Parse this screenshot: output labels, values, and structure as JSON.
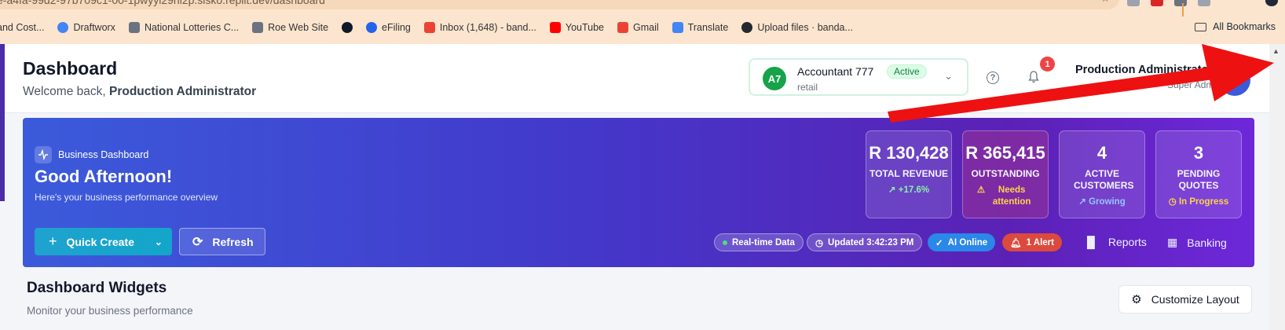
{
  "browser": {
    "url_fragment": "e-a4fa-99d2-97b709c1-00-1pwyyl29hl2p.sisko.replit.dev/dashboard",
    "bookmarks": [
      {
        "label": "and Cost...",
        "icon": "page-icon",
        "color": "#9ca3af"
      },
      {
        "label": "Draftworx",
        "icon": "chrome-icon",
        "color": "#4285f4"
      },
      {
        "label": "National Lotteries C...",
        "icon": "flag-icon",
        "color": "#6b7280"
      },
      {
        "label": "Roe Web Site",
        "icon": "image-icon",
        "color": "#6b7280"
      },
      {
        "label": "",
        "icon": "globe-icon",
        "color": "#111827"
      },
      {
        "label": "eFiling",
        "icon": "efiling-icon",
        "color": "#2563eb"
      },
      {
        "label": "Inbox (1,648) - band...",
        "icon": "gmail-icon",
        "color": "#ea4335"
      },
      {
        "label": "YouTube",
        "icon": "youtube-icon",
        "color": "#ff0000"
      },
      {
        "label": "Gmail",
        "icon": "gmail-icon",
        "color": "#ea4335"
      },
      {
        "label": "Translate",
        "icon": "translate-icon",
        "color": "#4285f4"
      },
      {
        "label": "Upload files · banda...",
        "icon": "github-icon",
        "color": "#24292f"
      }
    ],
    "all_bookmarks": "All Bookmarks"
  },
  "header": {
    "title": "Dashboard",
    "welcome_prefix": "Welcome back,",
    "welcome_name": "Production Administrator",
    "account": {
      "initials": "A7",
      "name": "Accountant 777",
      "status": "Active",
      "type": "retail"
    },
    "notifications_count": "1",
    "user_name": "Production Administrator",
    "user_role": "Super Admin"
  },
  "hero": {
    "tag": "Business Dashboard",
    "greeting": "Good Afternoon!",
    "description": "Here's your business performance overview",
    "quick_create": "Quick Create",
    "refresh": "Refresh",
    "stats": [
      {
        "value": "R 130,428",
        "label": "TOTAL REVENUE",
        "sub": "+17.6%",
        "sub_color": "#86efac",
        "icon": "trend-up-icon"
      },
      {
        "value": "R 365,415",
        "label": "OUTSTANDING",
        "sub": "Needs attention",
        "sub_color": "#fcd34d",
        "icon": "warning-icon"
      },
      {
        "value": "4",
        "label": "ACTIVE CUSTOMERS",
        "sub": "Growing",
        "sub_color": "#93c5fd",
        "icon": "chart-up-icon"
      },
      {
        "value": "3",
        "label": "PENDING QUOTES",
        "sub": "In Progress",
        "sub_color": "#fcd34d",
        "icon": "clock-icon"
      }
    ],
    "chips": {
      "realtime": "Real-time Data",
      "updated": "Updated 3:42:23 PM",
      "ai": "AI Online",
      "alert": "1 Alert"
    },
    "links": {
      "reports": "Reports",
      "banking": "Banking"
    }
  },
  "widgets": {
    "title": "Dashboard Widgets",
    "subtitle": "Monitor your business performance",
    "customize": "Customize Layout"
  },
  "colors": {
    "annotation_arrow": "#ee1111",
    "hero_start": "#3b5bdb",
    "hero_end": "#6d28d9"
  }
}
